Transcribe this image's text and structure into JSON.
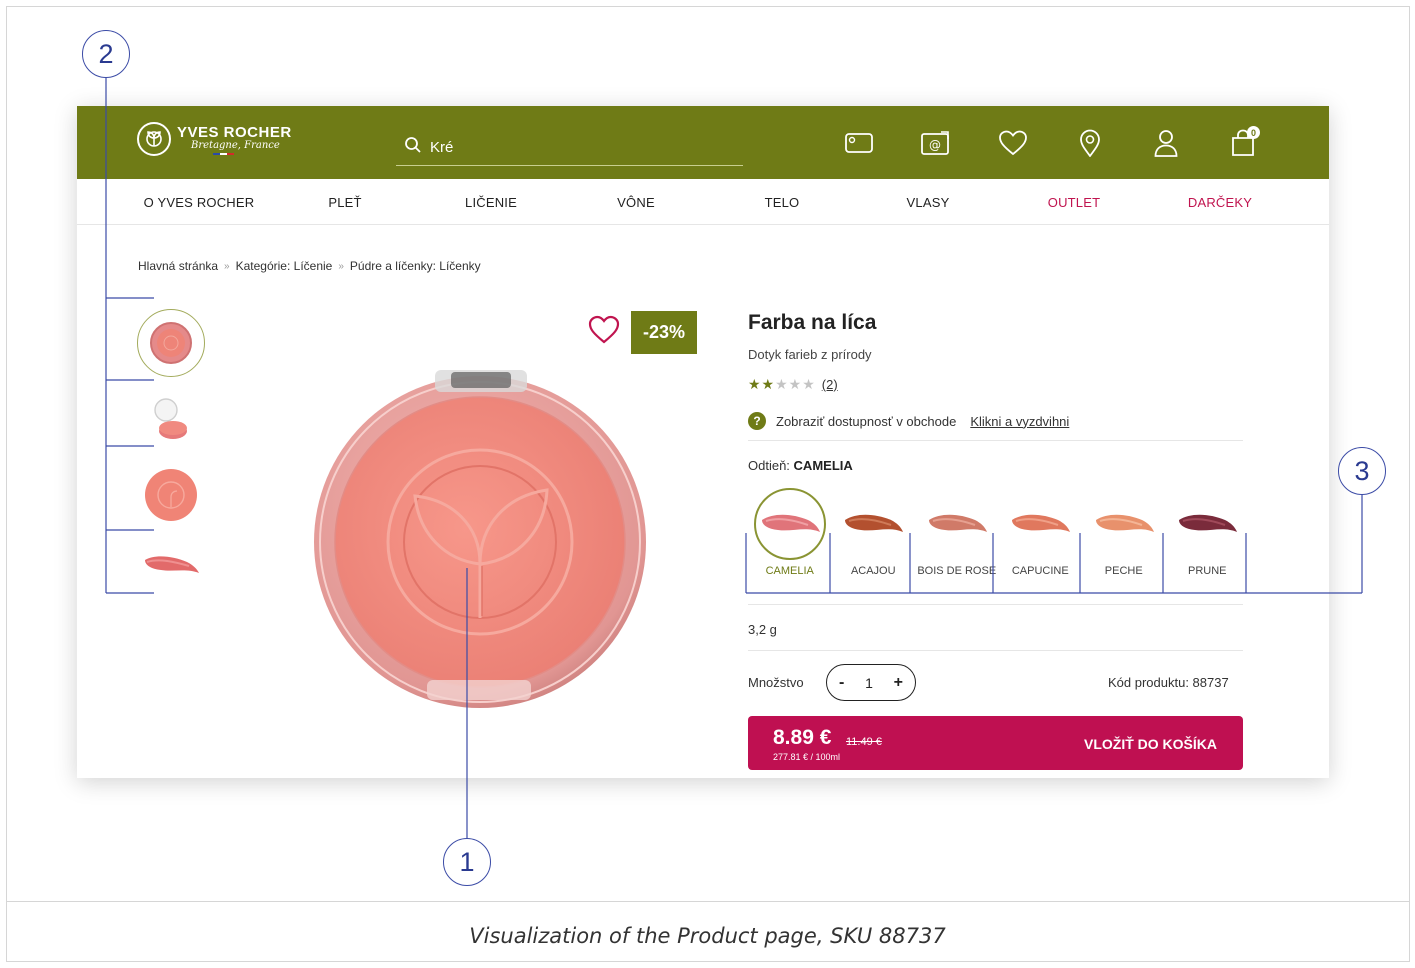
{
  "caption": "Visualization of the Product page, SKU 88737",
  "header": {
    "brand": "YVES ROCHER",
    "brand_sub": "Bretagne, France",
    "search_value": "Kré",
    "cart_count": "0"
  },
  "nav": [
    "O YVES ROCHER",
    "PLEŤ",
    "LIČENIE",
    "VÔNE",
    "TELO",
    "VLASY",
    "OUTLET",
    "DARČEKY"
  ],
  "breadcrumb": [
    "Hlavná stránka",
    "Kategórie: Líčenie",
    "Púdre a líčenky: Líčenky"
  ],
  "product": {
    "discount": "-23%",
    "title": "Farba na líca",
    "subtitle": "Dotyk farieb z prírody",
    "rating_value": 2,
    "rating_max": 5,
    "rating_count": "(2)",
    "availability_text": "Zobraziť dostupnosť v obchode",
    "availability_link": "Klikni a vyzdvihni",
    "shade_label": "Odtieň:",
    "shade_value": "CAMELIA",
    "shades": [
      {
        "name": "CAMELIA",
        "color": "#e0747a"
      },
      {
        "name": "ACAJOU",
        "color": "#b3502f"
      },
      {
        "name": "BOIS DE ROSE",
        "color": "#d07a68"
      },
      {
        "name": "CAPUCINE",
        "color": "#e0785e"
      },
      {
        "name": "PECHE",
        "color": "#e8916c"
      },
      {
        "name": "PRUNE",
        "color": "#7a2b3b"
      }
    ],
    "weight": "3,2 g",
    "quantity_label": "Množstvo",
    "quantity": "1",
    "code": "Kód produktu: 88737",
    "price": "8.89 €",
    "old_price": "11.49 €",
    "unit_price": "277.81 € / 100ml",
    "buy_label": "VLOŽIŤ DO KOŠÍKA"
  },
  "callouts": [
    "1",
    "2",
    "3"
  ],
  "colors": {
    "brand_green": "#6f7b16",
    "accent_red": "#bf1051",
    "outlet_pink": "#c0144f",
    "annotation_blue": "#3b4ba6"
  }
}
